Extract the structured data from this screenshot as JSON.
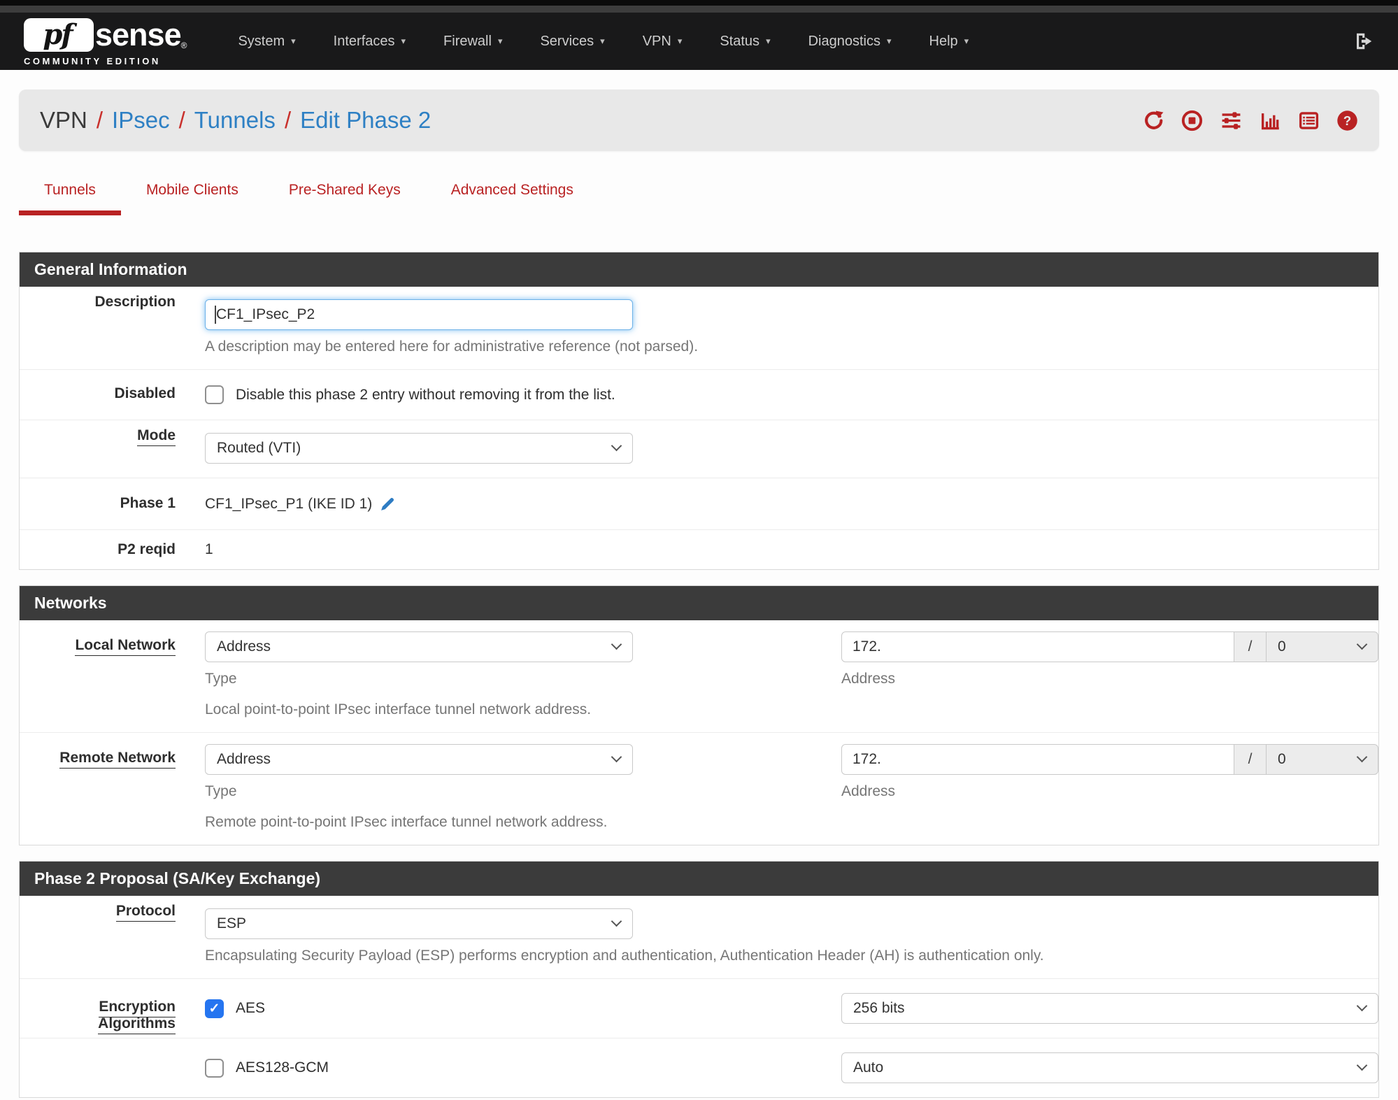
{
  "colors": {
    "accent_red": "#b92223",
    "link_blue": "#2e80c4",
    "panel_header": "#3b3b3b",
    "breadcrumb_bg": "#e8e8e8",
    "checkbox_checked": "#2575f0"
  },
  "navbar": {
    "brand": {
      "pf": "pf",
      "sense": "sense",
      "reg": "®",
      "edition": "COMMUNITY EDITION"
    },
    "items": [
      {
        "label": "System"
      },
      {
        "label": "Interfaces"
      },
      {
        "label": "Firewall"
      },
      {
        "label": "Services"
      },
      {
        "label": "VPN"
      },
      {
        "label": "Status"
      },
      {
        "label": "Diagnostics"
      },
      {
        "label": "Help"
      }
    ]
  },
  "breadcrumb": {
    "separator": "/",
    "items": [
      {
        "label": "VPN"
      },
      {
        "label": "IPsec"
      },
      {
        "label": "Tunnels"
      },
      {
        "label": "Edit Phase 2"
      }
    ]
  },
  "tabs": [
    {
      "label": "Tunnels",
      "active": true
    },
    {
      "label": "Mobile Clients",
      "active": false
    },
    {
      "label": "Pre-Shared Keys",
      "active": false
    },
    {
      "label": "Advanced Settings",
      "active": false
    }
  ],
  "sections": {
    "general": {
      "title": "General Information",
      "description": {
        "label": "Description",
        "value": "CF1_IPsec_P2",
        "help": "A description may be entered here for administrative reference (not parsed)."
      },
      "disabled": {
        "label": "Disabled",
        "checkbox_label": "Disable this phase 2 entry without removing it from the list.",
        "checked": false
      },
      "mode": {
        "label": "Mode",
        "value": "Routed (VTI)"
      },
      "phase1": {
        "label": "Phase 1",
        "value": "CF1_IPsec_P1 (IKE ID 1)"
      },
      "p2reqid": {
        "label": "P2 reqid",
        "value": "1"
      }
    },
    "networks": {
      "title": "Networks",
      "local": {
        "label": "Local Network",
        "type_value": "Address",
        "type_help": "Type",
        "address_value": "172.",
        "separator": "/",
        "mask_value": "0",
        "address_help": "Address",
        "description": "Local point-to-point IPsec interface tunnel network address."
      },
      "remote": {
        "label": "Remote Network",
        "type_value": "Address",
        "type_help": "Type",
        "address_value": "172.",
        "separator": "/",
        "mask_value": "0",
        "address_help": "Address",
        "description": "Remote point-to-point IPsec interface tunnel network address."
      }
    },
    "proposal": {
      "title": "Phase 2 Proposal (SA/Key Exchange)",
      "protocol": {
        "label": "Protocol",
        "value": "ESP",
        "help": "Encapsulating Security Payload (ESP) performs encryption and authentication, Authentication Header (AH) is authentication only."
      },
      "encryption": {
        "label": "Encryption Algorithms",
        "rows": [
          {
            "name": "AES",
            "checked": true,
            "keylen": "256 bits"
          },
          {
            "name": "AES128-GCM",
            "checked": false,
            "keylen": "Auto"
          }
        ]
      }
    }
  }
}
